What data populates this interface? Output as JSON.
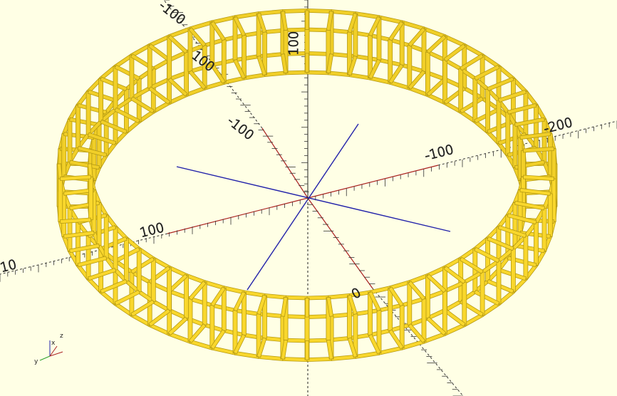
{
  "viewport": {
    "background": "#ffffe5",
    "model_color": "#f9d72c",
    "model_edge_color": "#b59a12",
    "axis_colors": {
      "x": "#aa2222",
      "y": "#2222aa",
      "z": "#222222"
    }
  },
  "axis_labels": {
    "x_pos": "100",
    "x_neg": "-100",
    "x_neg_far": "-200",
    "y_pos": "100",
    "y_neg": "-100",
    "z_pos": "100",
    "left_edge": "10",
    "front": "0"
  },
  "axes_gizmo": {
    "x": "x",
    "y": "y",
    "z": "z"
  }
}
